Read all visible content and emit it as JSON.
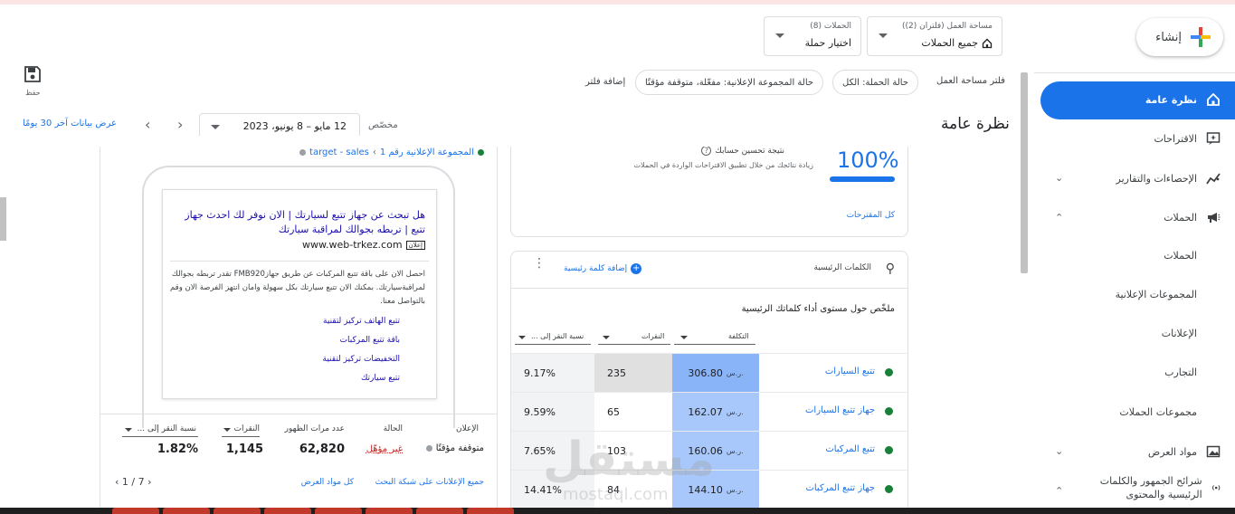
{
  "header": {
    "create_label": "إنشاء",
    "workspace_small": "مساحة العمل (فلتران (2))",
    "workspace_main": "جميع الحملات",
    "campaigns_small": "الحملات (8)",
    "campaigns_main": "اختيار حملة",
    "save_label": "حفظ"
  },
  "filters": {
    "label": "فلتر مساحة العمل",
    "chips": [
      "حالة الحملة: الكل",
      "حالة المجموعة الإعلانية: مفعّلة، متوقفة مؤقتًا"
    ],
    "add_filter": "إضافة فلتر"
  },
  "page": {
    "title": "نظرة عامة",
    "custom_label": "مخصّص",
    "date_range": "12 مايو – 8 يونيو، 2023",
    "last30": "عرض بيانات آخر 30 يومًا"
  },
  "sidebar": {
    "items": [
      {
        "label": "نظرة عامة"
      },
      {
        "label": "الاقتراحات"
      },
      {
        "label": "الإحصاءات والتقارير"
      },
      {
        "label": "الحملات"
      },
      {
        "label": "الحملات"
      },
      {
        "label": "المجموعات الإعلانية"
      },
      {
        "label": "الإعلانات"
      },
      {
        "label": "التجارب"
      },
      {
        "label": "مجموعات الحملات"
      },
      {
        "label": "مواد العرض"
      },
      {
        "label": "شرائح الجمهور والكلمات الرئيسية والمحتوى"
      }
    ]
  },
  "optimization": {
    "score": "100%",
    "score_value": 1.0,
    "title": "نتيجة تحسين حسابك",
    "description": "زيادة نتائجك من خلال تطبيق الاقتراحات الواردة في الحملات",
    "all_link": "كل المقترحات"
  },
  "keywords": {
    "title": "الكلمات الرئيسية",
    "add_label": "إضافة كلمة رئيسية",
    "summary": "ملخّص حول مستوى أداء كلماتك الرئيسية",
    "columns": {
      "cost": "التكلفة",
      "clicks": "النقرات",
      "ctr": "نسبة النقر إلى ..."
    },
    "currency": "ر.س.",
    "rows": [
      {
        "name": "تتبع السيارات",
        "cost": "306.80",
        "clicks": "235",
        "ctr": "9.17%"
      },
      {
        "name": "جهاز تتبع السيارات",
        "cost": "162.07",
        "clicks": "65",
        "ctr": "9.59%"
      },
      {
        "name": "تتبع المركبات",
        "cost": "160.06",
        "clicks": "103",
        "ctr": "7.65%"
      },
      {
        "name": "جهاز تتبع المركبات",
        "cost": "144.10",
        "clicks": "84",
        "ctr": "14.41%"
      }
    ]
  },
  "ad": {
    "breadcrumb_campaign": "target - sales",
    "breadcrumb_sep": "›",
    "breadcrumb_group": "المجموعة الإعلانية رقم 1",
    "headline": "هل تبحث عن جهاز تتبع لسيارتك | الان نوفر لك احدث جهاز تتبع | تربطه بجوالك لمراقبة سيارتك",
    "badge": "إعلان",
    "url": "www.web-trkez.com",
    "description": "احصل الان على باقة تتبع المركبات عن طريق جهازFMB920 تقدر تربطه بجوالك لمراقبةسيارتك. بمكنك الان تتبع سيارتك بكل سهولة وامان انتهز الفرصة الان وقم بالتواصل معنا.",
    "sitelinks": [
      "تتبع الهاتف تركيز لتقنية",
      "باقة تتبع المركبات",
      "التخفيضات تركيز لتقنية",
      "تتبع سيارتك"
    ],
    "stats_labels": {
      "ad": "الإعلان",
      "status": "الحالة",
      "impressions": "عدد مرات الظهور",
      "clicks": "النقرات",
      "ctr": "نسبة النقر إلى ..."
    },
    "stats_values": {
      "ad": "متوقفة مؤقتًا",
      "status": "غير مؤهّل",
      "impressions": "62,820",
      "clicks": "1,145",
      "ctr": "1.82%"
    },
    "footer_all_ads": "جميع الإعلانات على شبكة البحث",
    "footer_assets": "كل مواد العرض",
    "pager": "1 / 7"
  },
  "watermark": {
    "text": "مستقل",
    "sub": "mostaql.com"
  },
  "colors": {
    "accent": "#1a73e8",
    "cost_heat": "#a8c7fa",
    "cost_heat_strong": "#8ab4f8",
    "clicks_heat": "#e0e0e0",
    "ctr_heat": "#f1f3f4"
  }
}
